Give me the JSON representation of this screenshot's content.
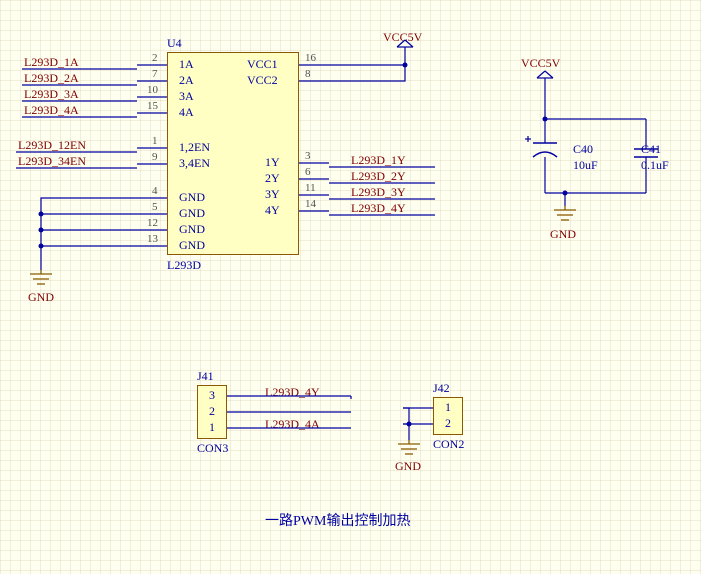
{
  "ic": {
    "designator": "U4",
    "part": "L293D",
    "left_pins": [
      {
        "num": "2",
        "name": "1A"
      },
      {
        "num": "7",
        "name": "2A"
      },
      {
        "num": "10",
        "name": "3A"
      },
      {
        "num": "15",
        "name": "4A"
      },
      {
        "num": "1",
        "name": "1,2EN"
      },
      {
        "num": "9",
        "name": "3,4EN"
      },
      {
        "num": "4",
        "name": "GND"
      },
      {
        "num": "5",
        "name": "GND"
      },
      {
        "num": "12",
        "name": "GND"
      },
      {
        "num": "13",
        "name": "GND"
      }
    ],
    "right_pins": [
      {
        "num": "16",
        "name": "VCC1"
      },
      {
        "num": "8",
        "name": "VCC2"
      },
      {
        "num": "3",
        "name": "1Y"
      },
      {
        "num": "6",
        "name": "2Y"
      },
      {
        "num": "11",
        "name": "3Y"
      },
      {
        "num": "14",
        "name": "4Y"
      }
    ]
  },
  "nets_left": [
    "L293D_1A",
    "L293D_2A",
    "L293D_3A",
    "L293D_4A",
    "L293D_12EN",
    "L293D_34EN"
  ],
  "nets_right": [
    "L293D_1Y",
    "L293D_2Y",
    "L293D_3Y",
    "L293D_4Y"
  ],
  "power": {
    "vcc5v_a": "VCC5V",
    "vcc5v_b": "VCC5V",
    "gnd": "GND"
  },
  "caps": {
    "c40": {
      "ref": "C40",
      "val": "10uF"
    },
    "c41": {
      "ref": "C41",
      "val": "0.1uF"
    }
  },
  "j41": {
    "ref": "J41",
    "part": "CON3",
    "pins": [
      "3",
      "2",
      "1"
    ],
    "nets": {
      "p3": "L293D_4Y",
      "p1": "L293D_4A"
    }
  },
  "j42": {
    "ref": "J42",
    "part": "CON2",
    "pins": [
      "1",
      "2"
    ]
  },
  "caption": "一路PWM输出控制加热"
}
